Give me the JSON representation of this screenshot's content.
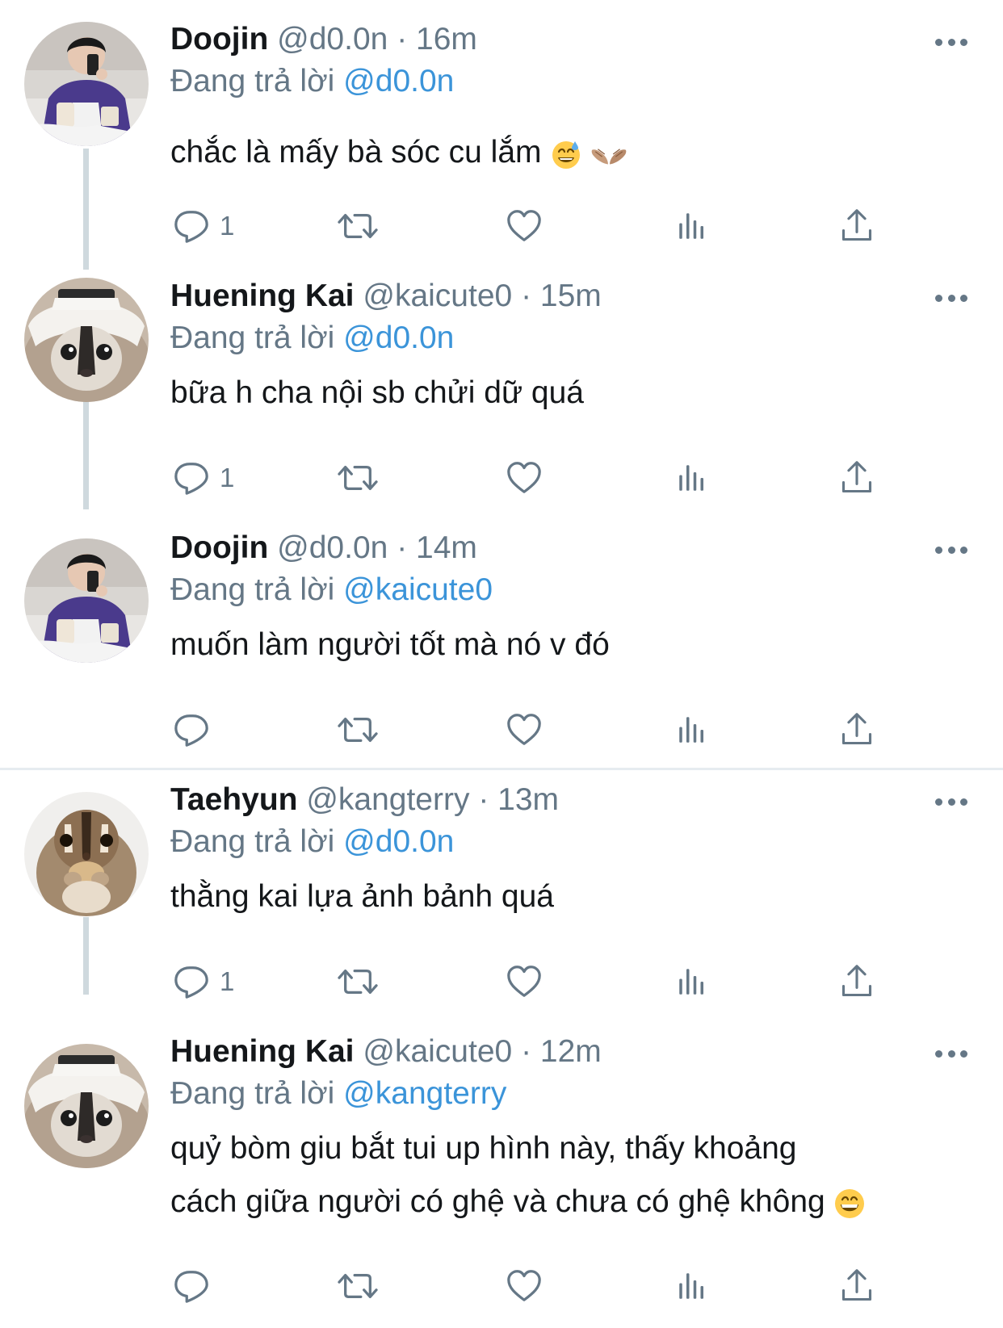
{
  "reply_prefix": "Đang trả lời",
  "tweets": [
    {
      "name": "Doojin",
      "handle": "@d0.0n",
      "separator": "·",
      "time": "16m",
      "reply_to": "@d0.0n",
      "lines": [
        "chắc là mấy bà sóc cu lắm"
      ],
      "reply_count": "1",
      "avatar": "doojin-avatar"
    },
    {
      "name": "Huening Kai",
      "handle": "@kaicute0",
      "separator": "·",
      "time": "15m",
      "reply_to": "@d0.0n",
      "lines": [
        "bữa h cha nội sb chửi dữ quá"
      ],
      "reply_count": "1",
      "avatar": "kai-avatar"
    },
    {
      "name": "Doojin",
      "handle": "@d0.0n",
      "separator": "·",
      "time": "14m",
      "reply_to": "@kaicute0",
      "lines": [
        "muốn làm người tốt mà nó v đó"
      ],
      "reply_count": "",
      "avatar": "doojin-avatar"
    },
    {
      "name": "Taehyun",
      "handle": "@kangterry",
      "separator": "·",
      "time": "13m",
      "reply_to": "@d0.0n",
      "lines": [
        "thằng kai lựa ảnh bảnh quá"
      ],
      "reply_count": "1",
      "avatar": "taehyun-avatar"
    },
    {
      "name": "Huening Kai",
      "handle": "@kaicute0",
      "separator": "·",
      "time": "12m",
      "reply_to": "@kangterry",
      "lines": [
        "quỷ bòm giu bắt tui up hình này, thấy khoảng",
        "cách giữa người có ghệ và chưa có ghệ không"
      ],
      "reply_count": "",
      "avatar": "kai-avatar"
    }
  ],
  "icons": {
    "reply": "reply-icon",
    "retweet": "retweet-icon",
    "like": "heart-icon",
    "analytics": "analytics-icon",
    "share": "share-icon",
    "more": "more-icon"
  },
  "colors": {
    "text": "#14171a",
    "secondary": "#657786",
    "mention": "#3b94d9",
    "thread_line": "#cfd9de",
    "divider": "#e6ecf0"
  }
}
